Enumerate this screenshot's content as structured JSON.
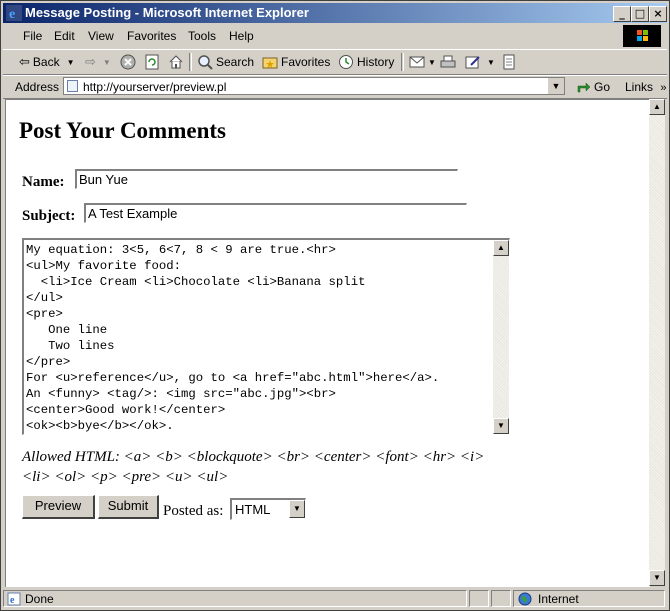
{
  "window": {
    "title": "Message Posting - Microsoft Internet Explorer"
  },
  "menu": [
    "File",
    "Edit",
    "View",
    "Favorites",
    "Tools",
    "Help"
  ],
  "toolbar": {
    "back": "Back",
    "search": "Search",
    "favorites": "Favorites",
    "history": "History"
  },
  "address": {
    "label": "Address",
    "url": "http://yourserver/preview.pl",
    "go": "Go",
    "links": "Links"
  },
  "page": {
    "heading": "Post Your Comments",
    "name_label": "Name:",
    "name_value": "Bun Yue",
    "subject_label": "Subject:",
    "subject_value": "A Test Example",
    "message_lines": [
      "My equation: 3<5, 6<7, 8 < 9 are true.<hr>",
      "<ul>My favorite food:",
      "  <li>Ice Cream <li>Chocolate <li>Banana split",
      "</ul>",
      "<pre>",
      "   One line",
      "   Two lines",
      "</pre>",
      "For <u>reference</u>, go to <a href=\"abc.html\">here</a>.",
      "An <funny> <tag/>: <img src=\"abc.jpg\"><br>",
      "<center>Good work!</center>",
      "<ok><b>bye</b></ok>."
    ],
    "allowed_label": "Allowed HTML:",
    "allowed_tags": "<a> <b> <blockquote> <br> <center> <font> <hr> <i> <li> <ol> <p> <pre> <u> <ul>",
    "preview_button": "Preview",
    "submit_button": "Submit",
    "posted_as_label": "Posted as:",
    "posted_as_value": "HTML"
  },
  "status": {
    "text": "Done",
    "zone": "Internet"
  },
  "colors": {
    "titlebar_start": "#0a246a",
    "titlebar_end": "#a6caf0",
    "chrome": "#d4d0c8"
  }
}
